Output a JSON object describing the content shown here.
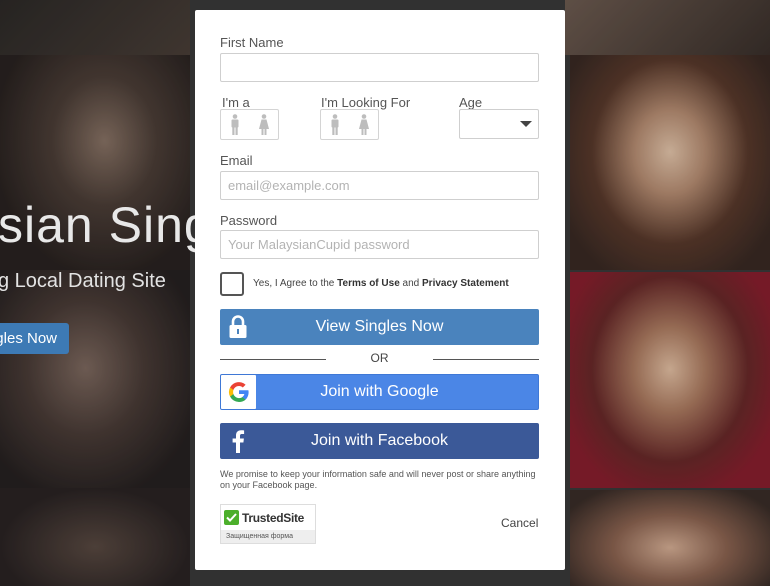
{
  "background": {
    "hero_title": "sian Sing",
    "hero_subtitle": "g Local Dating Site",
    "hero_button": "gles Now"
  },
  "form": {
    "first_name_label": "First Name",
    "first_name_value": "",
    "im_a_label": "I'm a",
    "looking_for_label": "I'm Looking For",
    "age_label": "Age",
    "age_value": "",
    "email_label": "Email",
    "email_placeholder": "email@example.com",
    "password_label": "Password",
    "password_placeholder": "Your MalaysianCupid password",
    "agree_prefix": "Yes, I Agree to the ",
    "terms_link": "Terms of Use",
    "agree_and": " and ",
    "privacy_link": "Privacy Statement"
  },
  "buttons": {
    "view_singles": "View Singles Now",
    "or": "OR",
    "google": "Join with Google",
    "facebook": "Join with Facebook",
    "cancel": "Cancel"
  },
  "promise_text": "We promise to keep your information safe and will never post or share anything on your Facebook page.",
  "trusted_site": {
    "name": "TrustedSite",
    "caption": "Защищенная форма"
  },
  "colors": {
    "view_button": "#4a83bd",
    "google_button": "#4b86e6",
    "facebook_button": "#3b5998",
    "trusted_green": "#4caf2b"
  },
  "icons": [
    "lock-icon",
    "google-icon",
    "facebook-icon",
    "male-icon",
    "female-icon",
    "check-icon",
    "chevron-down-icon"
  ]
}
